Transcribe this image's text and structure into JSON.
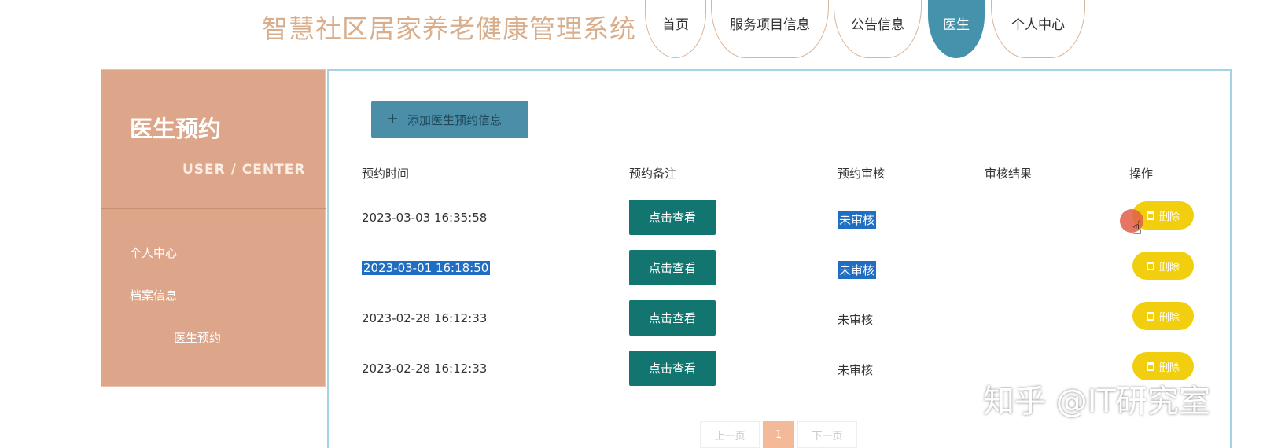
{
  "header": {
    "title": "智慧社区居家养老健康管理系统",
    "nav": [
      "首页",
      "服务项目信息",
      "公告信息",
      "医生",
      "个人中心"
    ],
    "active_tab": "医生"
  },
  "sidebar": {
    "title": "医生预约",
    "subtitle": "USER / CENTER",
    "items": [
      "个人中心",
      "档案信息",
      "医生预约"
    ]
  },
  "main": {
    "add_button_label": "添加医生预约信息",
    "columns": [
      "预约时间",
      "预约备注",
      "预约审核",
      "审核结果",
      "操作"
    ],
    "view_label": "点击查看",
    "delete_label": "删除",
    "rows": [
      {
        "time": "2023-03-03 16:35:58",
        "review": "未审核",
        "result": ""
      },
      {
        "time": "2023-03-01 16:18:50",
        "review": "未审核",
        "result": ""
      },
      {
        "time": "2023-02-28 16:12:33",
        "review": "未审核",
        "result": ""
      },
      {
        "time": "2023-02-28 16:12:33",
        "review": "未审核",
        "result": ""
      }
    ]
  },
  "pagination": {
    "prev": "上一页",
    "current": "1",
    "next": "下一页"
  },
  "watermark": "知乎 @IT研究室",
  "colors": {
    "accent": "#4592ad",
    "sidebar": "#dda68a",
    "view_button": "#127570",
    "delete_button": "#f1cf0f",
    "title": "#d9ae8c"
  }
}
